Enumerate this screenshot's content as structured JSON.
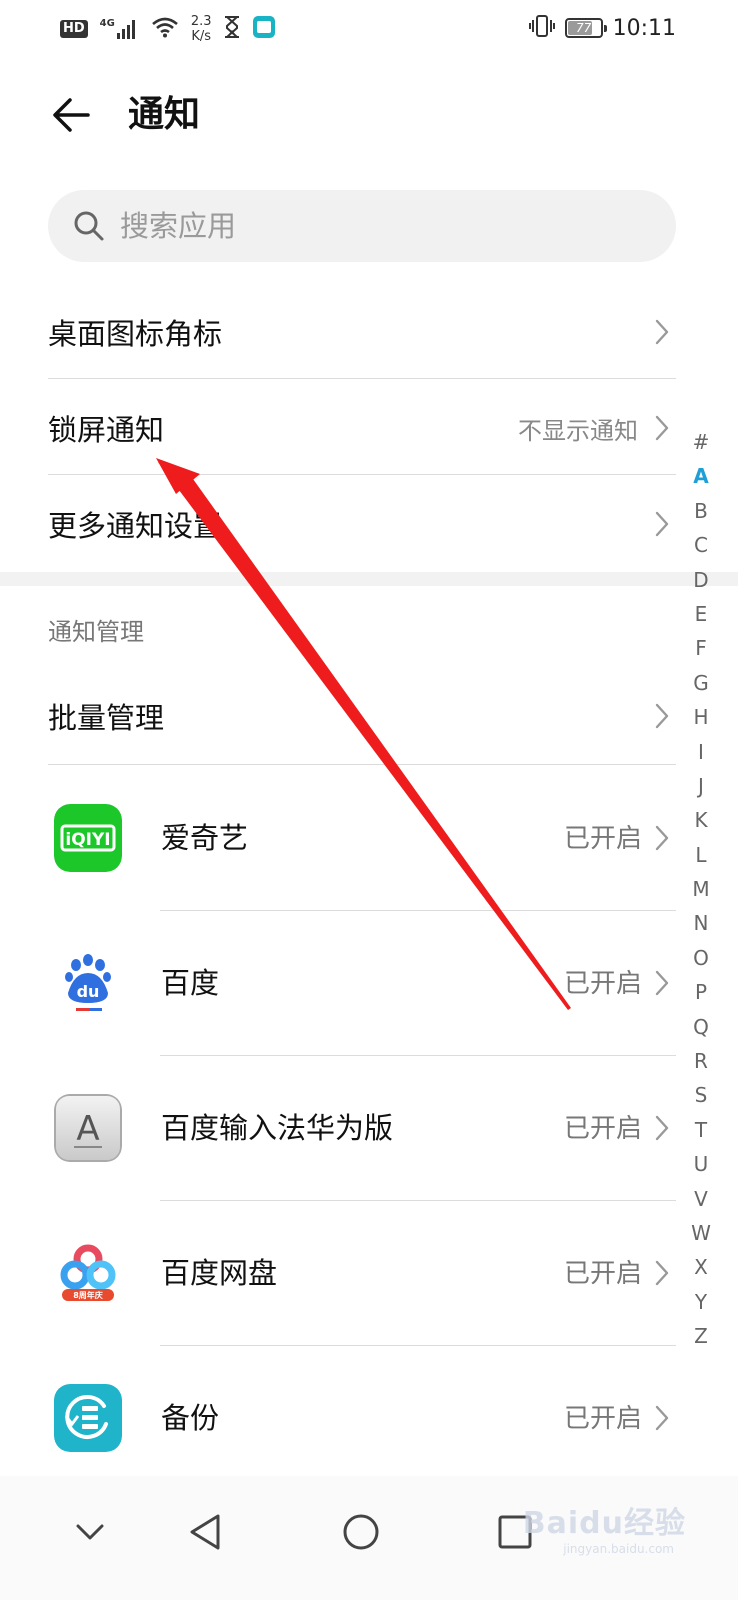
{
  "status_bar": {
    "hd": "HD",
    "network": "4G",
    "speed_value": "2.3",
    "speed_unit": "K/s",
    "battery": "77",
    "battery_level": 0.77,
    "time": "10:11"
  },
  "header": {
    "title": "通知"
  },
  "search": {
    "placeholder": "搜索应用"
  },
  "settings": [
    {
      "label": "桌面图标角标",
      "value": ""
    },
    {
      "label": "锁屏通知",
      "value": "不显示通知"
    },
    {
      "label": "更多通知设置",
      "value": ""
    }
  ],
  "section": {
    "title": "通知管理",
    "batch_label": "批量管理"
  },
  "apps": [
    {
      "name": "爱奇艺",
      "status": "已开启",
      "icon": "iqiyi-icon",
      "color": "#1cc729",
      "icon_text": "iQIYI"
    },
    {
      "name": "百度",
      "status": "已开启",
      "icon": "baidu-icon",
      "color": "#2f6fe0",
      "icon_text": "du"
    },
    {
      "name": "百度输入法华为版",
      "status": "已开启",
      "icon": "baidu-input-icon",
      "color": "#d8d8d8",
      "icon_text": "A"
    },
    {
      "name": "百度网盘",
      "status": "已开启",
      "icon": "baidu-netdisk-icon",
      "color": "#3aa0f0",
      "icon_text": "8周年庆"
    },
    {
      "name": "备份",
      "status": "已开启",
      "icon": "backup-icon",
      "color": "#1fb4c9",
      "icon_text": ""
    }
  ],
  "alpha_index": [
    "#",
    "A",
    "B",
    "C",
    "D",
    "E",
    "F",
    "G",
    "H",
    "I",
    "J",
    "K",
    "L",
    "M",
    "N",
    "O",
    "P",
    "Q",
    "R",
    "S",
    "T",
    "U",
    "V",
    "W",
    "X",
    "Y",
    "Z"
  ],
  "alpha_active": "A",
  "watermark": {
    "brand": "Baidu经验",
    "url": "jingyan.baidu.com"
  },
  "colors": {
    "accent": "#1ea0d6",
    "annotation_arrow": "#ee1c1c"
  }
}
